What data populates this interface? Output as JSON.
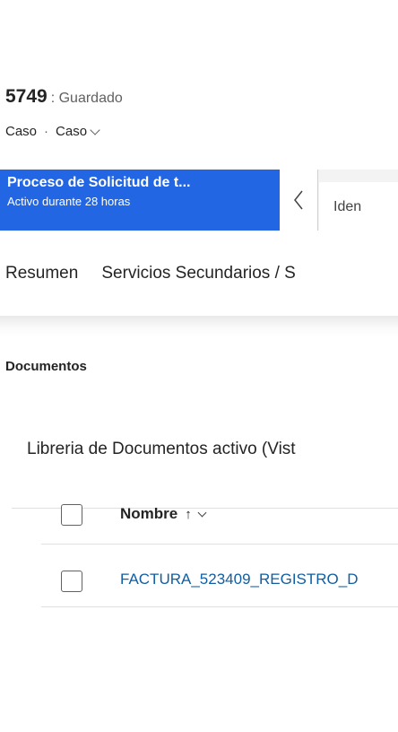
{
  "record": {
    "id": "5749",
    "status": ": Guardado",
    "entity": "Caso",
    "separator": "·",
    "form": "Caso"
  },
  "bpf": {
    "active_stage_name": "Proceso de Solicitud de t...",
    "active_duration": "Activo durante 28 horas",
    "next_stage_label": "Iden",
    "accent_color": "#2266e3"
  },
  "tabs": [
    {
      "label": "Resumen"
    },
    {
      "label": "Servicios Secundarios / S"
    }
  ],
  "documents": {
    "section_label": "Documentos",
    "library_title": "Libreria de Documentos activo (Vist",
    "column_header": "Nombre",
    "sort_indicator": "↑",
    "rows": [
      {
        "name": "FACTURA_523409_REGISTRO_D"
      }
    ],
    "link_color": "#115ea3"
  }
}
